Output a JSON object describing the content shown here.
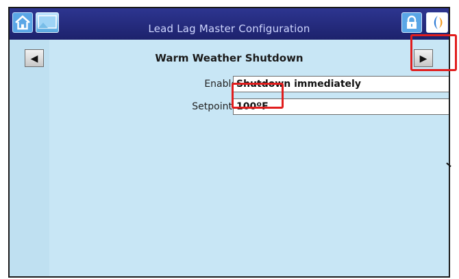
{
  "app": {
    "window_title": "Lead Lag Master Configuration"
  },
  "nav": {
    "prev_label": "◀",
    "next_label": "▶"
  },
  "page": {
    "title": "Warm Weather Shutdown"
  },
  "fields": [
    {
      "label": "Enable",
      "value": "Shutdown immediately"
    },
    {
      "label": "Setpoint",
      "value": "100ºF"
    }
  ],
  "icons": {
    "home": "home-icon",
    "screen": "screen-icon",
    "lock": "lock-icon",
    "logo": "logo-icon"
  },
  "colors": {
    "titlebar": "#1d226c",
    "background": "#c8e6f5",
    "highlight": "#e11d1d"
  }
}
